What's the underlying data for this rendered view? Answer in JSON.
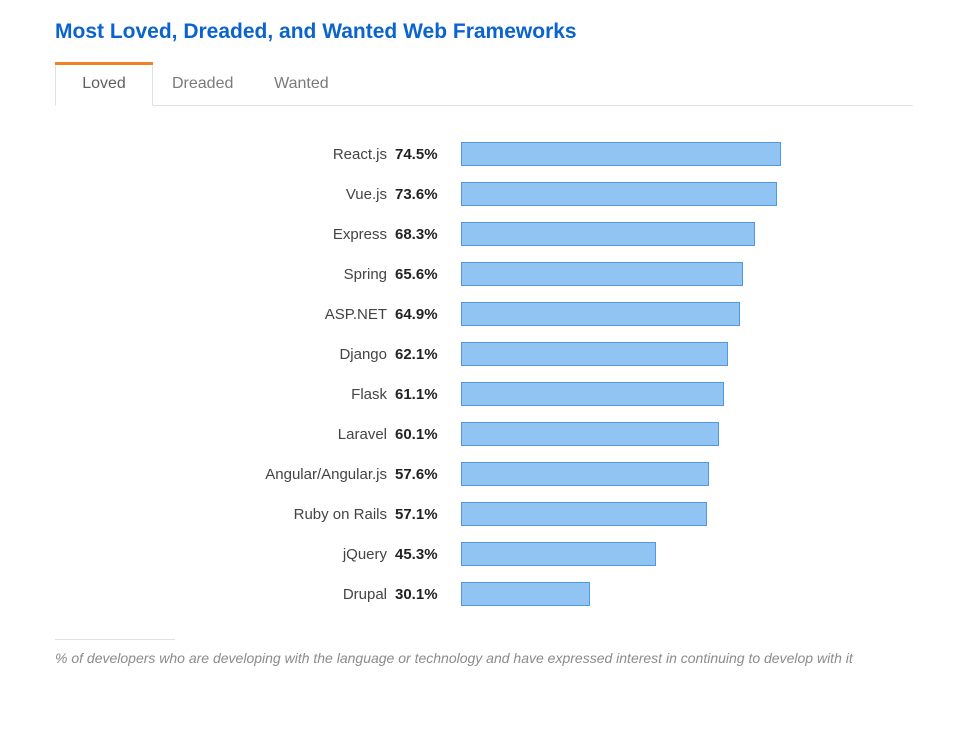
{
  "title": "Most Loved, Dreaded, and Wanted Web Frameworks",
  "tabs": [
    {
      "label": "Loved",
      "active": true
    },
    {
      "label": "Dreaded",
      "active": false
    },
    {
      "label": "Wanted",
      "active": false
    }
  ],
  "footnote": "% of developers who are developing with the language or technology and have expressed interest in continuing to develop with it",
  "colors": {
    "title": "#0b63ce",
    "tab_accent": "#f48024",
    "bar_fill": "#92c4f3",
    "bar_border": "#4f99e3"
  },
  "chart_data": {
    "type": "bar",
    "orientation": "horizontal",
    "title": "Most Loved, Dreaded, and Wanted Web Frameworks",
    "xlabel": "",
    "ylabel": "",
    "xlim": [
      0,
      100
    ],
    "value_suffix": "%",
    "categories": [
      "React.js",
      "Vue.js",
      "Express",
      "Spring",
      "ASP.NET",
      "Django",
      "Flask",
      "Laravel",
      "Angular/Angular.js",
      "Ruby on Rails",
      "jQuery",
      "Drupal"
    ],
    "values": [
      74.5,
      73.6,
      68.3,
      65.6,
      64.9,
      62.1,
      61.1,
      60.1,
      57.6,
      57.1,
      45.3,
      30.1
    ]
  }
}
